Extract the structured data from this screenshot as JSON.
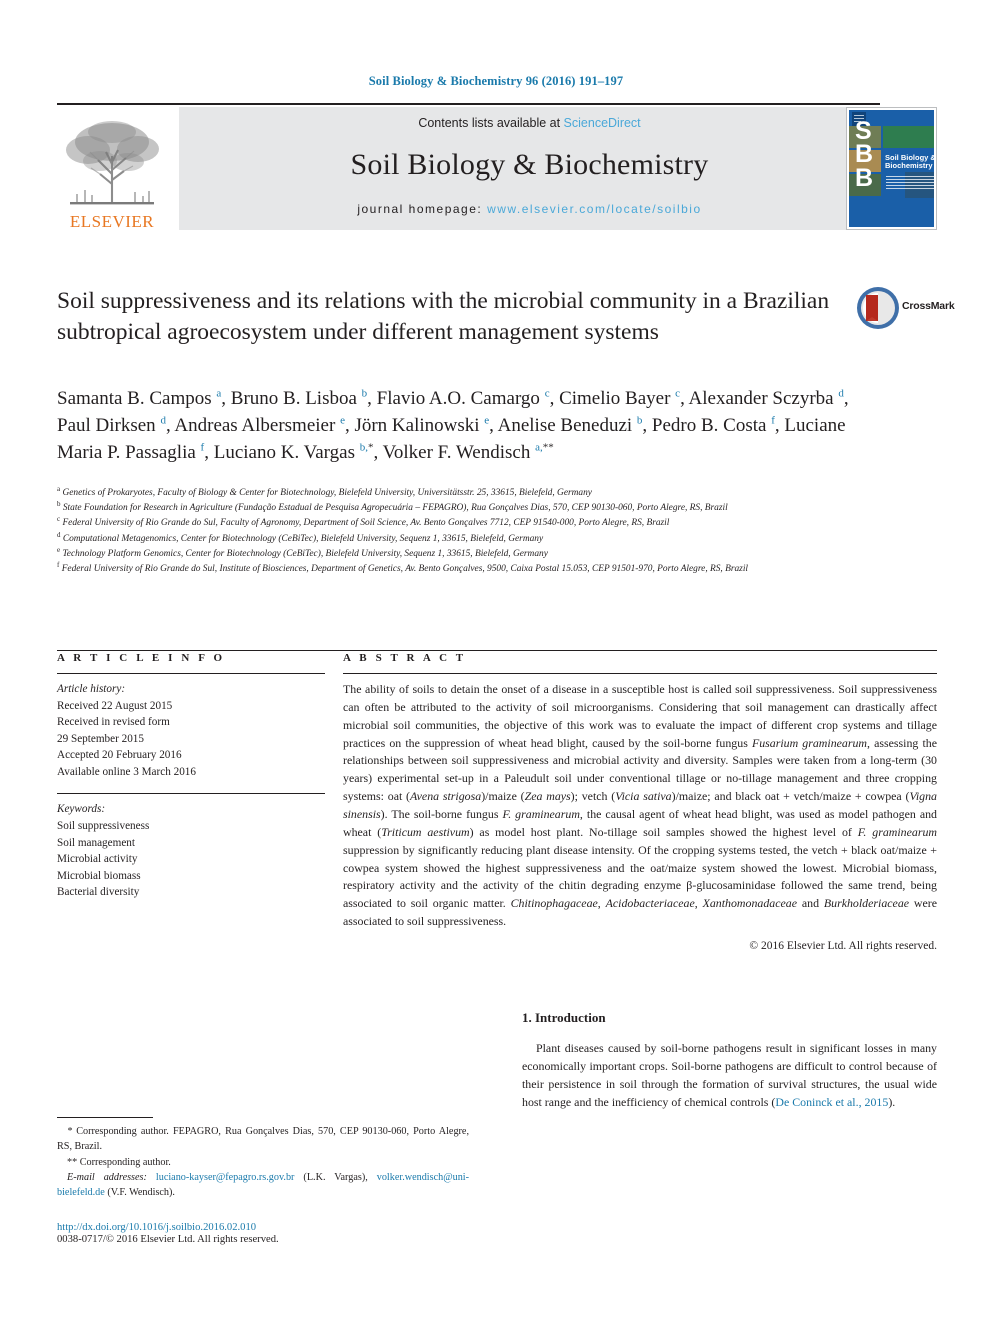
{
  "running_head": "Soil Biology & Biochemistry 96 (2016) 191–197",
  "masthead": {
    "publisher": "ELSEVIER",
    "contents_prefix": "Contents lists available at ",
    "contents_link": "ScienceDirect",
    "journal_title": "Soil Biology & Biochemistry",
    "homepage_label": "journal homepage:",
    "homepage_url": "www.elsevier.com/locate/soilbio",
    "cover": {
      "letters": "S\nB\nB",
      "title": "Soil Biology & Biochemistry"
    }
  },
  "article": {
    "title": "Soil suppressiveness and its relations with the microbial community in a Brazilian subtropical agroecosystem under different management systems",
    "crossmark_label": "CrossMark",
    "authors_html": "Samanta B. Campos <sup>a</sup>, Bruno B. Lisboa <sup>b</sup>, Flavio A.O. Camargo <sup>c</sup>, Cimelio Bayer <sup>c</sup>, Alexander Sczyrba <sup>d</sup>, Paul Dirksen <sup>d</sup>, Andreas Albersmeier <sup>e</sup>, Jörn Kalinowski <sup>e</sup>, Anelise Beneduzi <sup>b</sup>, Pedro B. Costa <sup>f</sup>, Luciane Maria P. Passaglia <sup>f</sup>, Luciano K. Vargas <sup>b,</sup><sup class=\"star\">*</sup>, Volker F. Wendisch <sup>a,</sup><sup class=\"star\">**</sup>",
    "affiliations": [
      {
        "marker": "a",
        "text": "Genetics of Prokaryotes, Faculty of Biology & Center for Biotechnology, Bielefeld University, Universitätsstr. 25, 33615, Bielefeld, Germany"
      },
      {
        "marker": "b",
        "text": "State Foundation for Research in Agriculture (Fundação Estadual de Pesquisa Agropecuária – FEPAGRO), Rua Gonçalves Dias, 570, CEP 90130-060, Porto Alegre, RS, Brazil"
      },
      {
        "marker": "c",
        "text": "Federal University of Rio Grande do Sul, Faculty of Agronomy, Department of Soil Science, Av. Bento Gonçalves 7712, CEP 91540-000, Porto Alegre, RS, Brazil"
      },
      {
        "marker": "d",
        "text": "Computational Metagenomics, Center for Biotechnology (CeBiTec), Bielefeld University, Sequenz 1, 33615, Bielefeld, Germany"
      },
      {
        "marker": "e",
        "text": "Technology Platform Genomics, Center for Biotechnology (CeBiTec), Bielefeld University, Sequenz 1, 33615, Bielefeld, Germany"
      },
      {
        "marker": "f",
        "text": "Federal University of Rio Grande do Sul, Institute of Biosciences, Department of Genetics, Av. Bento Gonçalves, 9500, Caixa Postal 15.053, CEP 91501-970, Porto Alegre, RS, Brazil"
      }
    ]
  },
  "article_info": {
    "heading": "A R T I C L E   I N F O",
    "history_label": "Article history:",
    "history": [
      "Received 22 August 2015",
      "Received in revised form",
      "29 September 2015",
      "Accepted 20 February 2016",
      "Available online 3 March 2016"
    ],
    "keywords_label": "Keywords:",
    "keywords": [
      "Soil suppressiveness",
      "Soil management",
      "Microbial activity",
      "Microbial biomass",
      "Bacterial diversity"
    ]
  },
  "abstract": {
    "heading": "A B S T R A C T",
    "body_html": "The ability of soils to detain the onset of a disease in a susceptible host is called soil suppressiveness. Soil suppressiveness can often be attributed to the activity of soil microorganisms. Considering that soil management can drastically affect microbial soil communities, the objective of this work was to evaluate the impact of different crop systems and tillage practices on the suppression of wheat head blight, caused by the soil-borne fungus <i>Fusarium graminearum</i>, assessing the relationships between soil suppressiveness and microbial activity and diversity. Samples were taken from a long-term (30 years) experimental set-up in a Paleudult soil under conventional tillage or no-tillage management and three cropping systems: oat (<i>Avena strigosa</i>)/maize (<i>Zea mays</i>); vetch (<i>Vicia sativa</i>)/maize; and black oat + vetch/maize + cowpea (<i>Vigna sinensis</i>). The soil-borne fungus <i>F. graminearum</i>, the causal agent of wheat head blight, was used as model pathogen and wheat (<i>Triticum aestivum</i>) as model host plant. No-tillage soil samples showed the highest level of <i>F. graminearum</i> suppression by significantly reducing plant disease intensity. Of the cropping systems tested, the vetch + black oat/maize + cowpea system showed the highest suppressiveness and the oat/maize system showed the lowest. Microbial biomass, respiratory activity and the activity of the chitin degrading enzyme β-glucosaminidase followed the same trend, being associated to soil organic matter. <i>Chitinophagaceae</i>, <i>Acidobacteriaceae</i>, <i>Xanthomonadaceae</i> and <i>Burkholderiaceae</i> were associated to soil suppressiveness.",
    "copyright": "© 2016 Elsevier Ltd. All rights reserved."
  },
  "introduction": {
    "heading": "1. Introduction",
    "paragraph_html": "Plant diseases caused by soil-borne pathogens result in significant losses in many economically important crops. Soil-borne pathogens are difficult to control because of their persistence in soil through the formation of survival structures, the usual wide host range and the inefficiency of chemical controls (<span class=\"cite\">De Coninck et al., 2015</span>)."
  },
  "footnotes": {
    "corresponding_1_html": "<span class=\"em\">*</span> Corresponding author. FEPAGRO, Rua Gonçalves Dias, 570, CEP 90130-060, Porto Alegre, RS, Brazil.",
    "corresponding_2_html": "** Corresponding author.",
    "emails_html": "<span class=\"em\">E-mail addresses:</span> <span class=\"lnk\">luciano-kayser@fepagro.rs.gov.br</span> (L.K. Vargas), <span class=\"lnk\">volker.wendisch@uni-bielefeld.de</span> (V.F. Wendisch).",
    "doi": "http://dx.doi.org/10.1016/j.soilbio.2016.02.010",
    "issn": "0038-0717/© 2016 Elsevier Ltd. All rights reserved."
  },
  "colors": {
    "link_blue": "#1a7aab",
    "light_blue": "#4aa8d8",
    "elsevier_orange": "#e87722",
    "banner_gray": "#e6e7e8",
    "cover_blue": "#1a5fa8"
  }
}
